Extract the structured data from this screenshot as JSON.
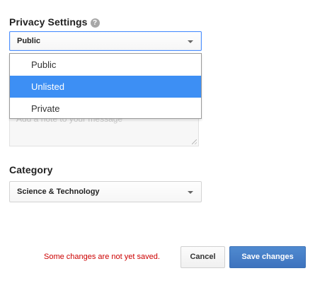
{
  "privacy": {
    "title": "Privacy Settings",
    "help_icon": "?",
    "selected": "Public",
    "options": [
      "Public",
      "Unlisted",
      "Private"
    ],
    "highlighted_option": "Unlisted",
    "message_placeholder": "Add a note to your message"
  },
  "category": {
    "title": "Category",
    "selected": "Science & Technology"
  },
  "footer": {
    "unsaved_notice": "Some changes are not yet saved.",
    "cancel_label": "Cancel",
    "save_label": "Save changes"
  },
  "colors": {
    "highlight": "#3d8ff4",
    "primary_button": "#4584c9",
    "warning_text": "#cc0000"
  }
}
